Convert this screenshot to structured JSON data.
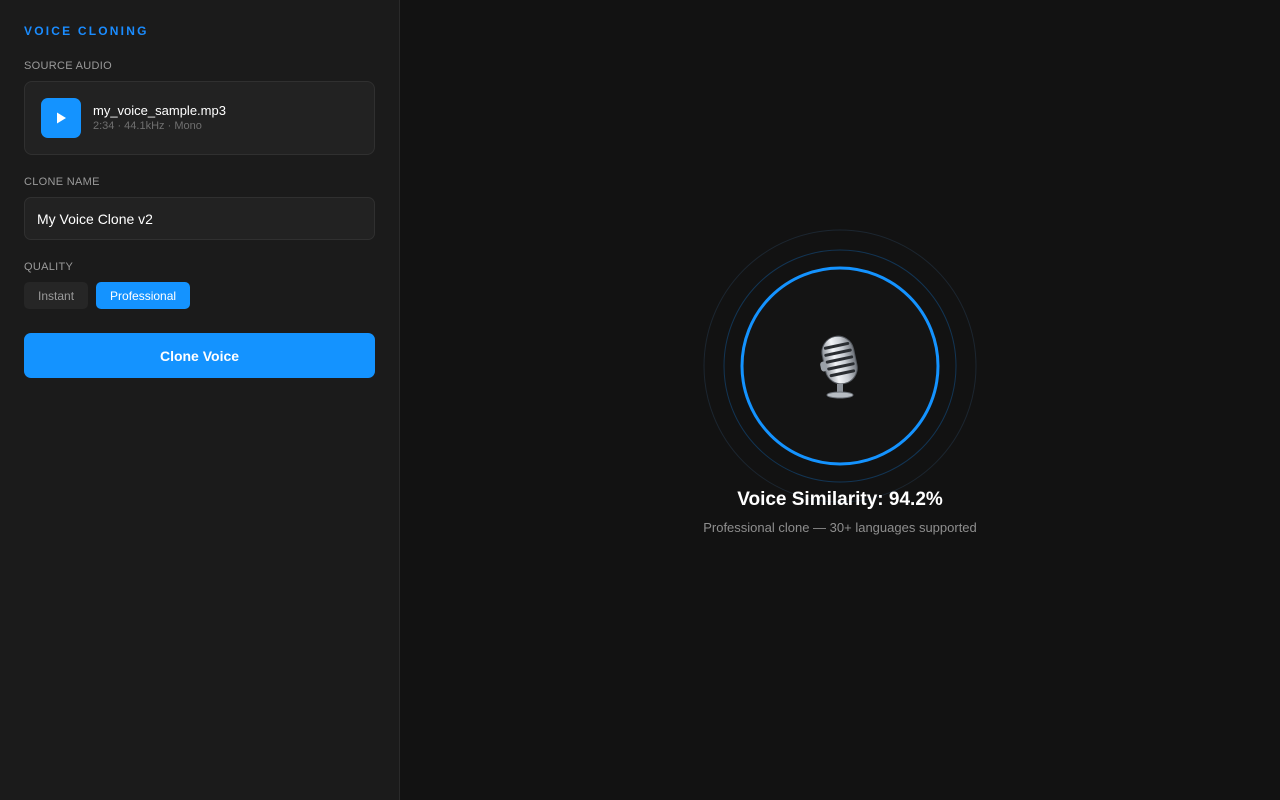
{
  "app": {
    "title": "VOICE CLONING"
  },
  "source": {
    "label": "SOURCE AUDIO",
    "file_name": "my_voice_sample.mp3",
    "file_meta": "2:34 · 44.1kHz · Mono",
    "play_icon": "play-icon"
  },
  "clone": {
    "label": "CLONE NAME",
    "value": "My Voice Clone v2"
  },
  "quality": {
    "label": "QUALITY",
    "options": [
      "Instant",
      "Professional"
    ],
    "selected": "Professional"
  },
  "actions": {
    "clone_label": "Clone Voice"
  },
  "result": {
    "similarity_label": "Voice Similarity: 94.2%",
    "similarity_value": 94.2,
    "caption": "Professional clone — 30+ languages supported",
    "center_icon": "microphone-icon"
  },
  "colors": {
    "accent": "#1493ff",
    "sidebar_bg": "#1b1b1b",
    "main_bg": "#121212"
  }
}
